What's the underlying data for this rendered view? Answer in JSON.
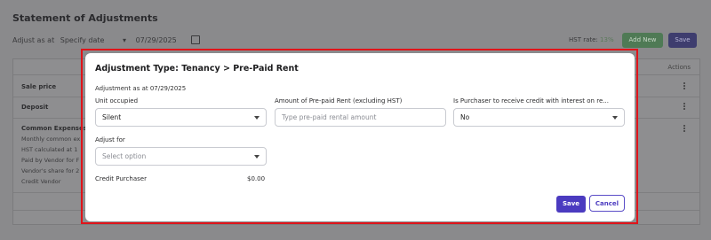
{
  "background": {
    "title": "Statement of Adjustments",
    "adjust_as_at_label": "Adjust as at",
    "specify_date_select": "Specify date",
    "date_value": "07/29/2025",
    "hst_rate_label": "HST rate:",
    "hst_rate_value": "13%",
    "add_new_button": "Add New",
    "save_button": "Save",
    "actions_header": "Actions",
    "rows": {
      "sale_price": "Sale price",
      "deposit": "Deposit",
      "common_expenses": "Common Expenses",
      "common_sub1": "Monthly common ex",
      "common_sub2": "HST calculated at 1",
      "common_sub3": "Paid by Vendor for F",
      "common_sub4": "Vendor's share for 2",
      "common_sub5": "Credit Vendor"
    }
  },
  "modal": {
    "title": "Adjustment Type: Tenancy > Pre-Paid Rent",
    "as_at": "Adjustment as at 07/29/2025",
    "unit_occupied_label": "Unit occupied",
    "unit_occupied_value": "Silent",
    "amount_label": "Amount of Pre-paid Rent (excluding HST)",
    "amount_placeholder": "Type pre-paid rental amount",
    "interest_label": "Is Purchaser to receive credit with interest on re...",
    "interest_value": "No",
    "adjust_for_label": "Adjust for",
    "adjust_for_placeholder": "Select option",
    "credit_label": "Credit Purchaser",
    "credit_value": "$0.00",
    "save_button": "Save",
    "cancel_button": "Cancel"
  },
  "colors": {
    "accent": "#4b3bc0",
    "highlight_border": "#e0141a",
    "add_button": "#4f7a55"
  }
}
